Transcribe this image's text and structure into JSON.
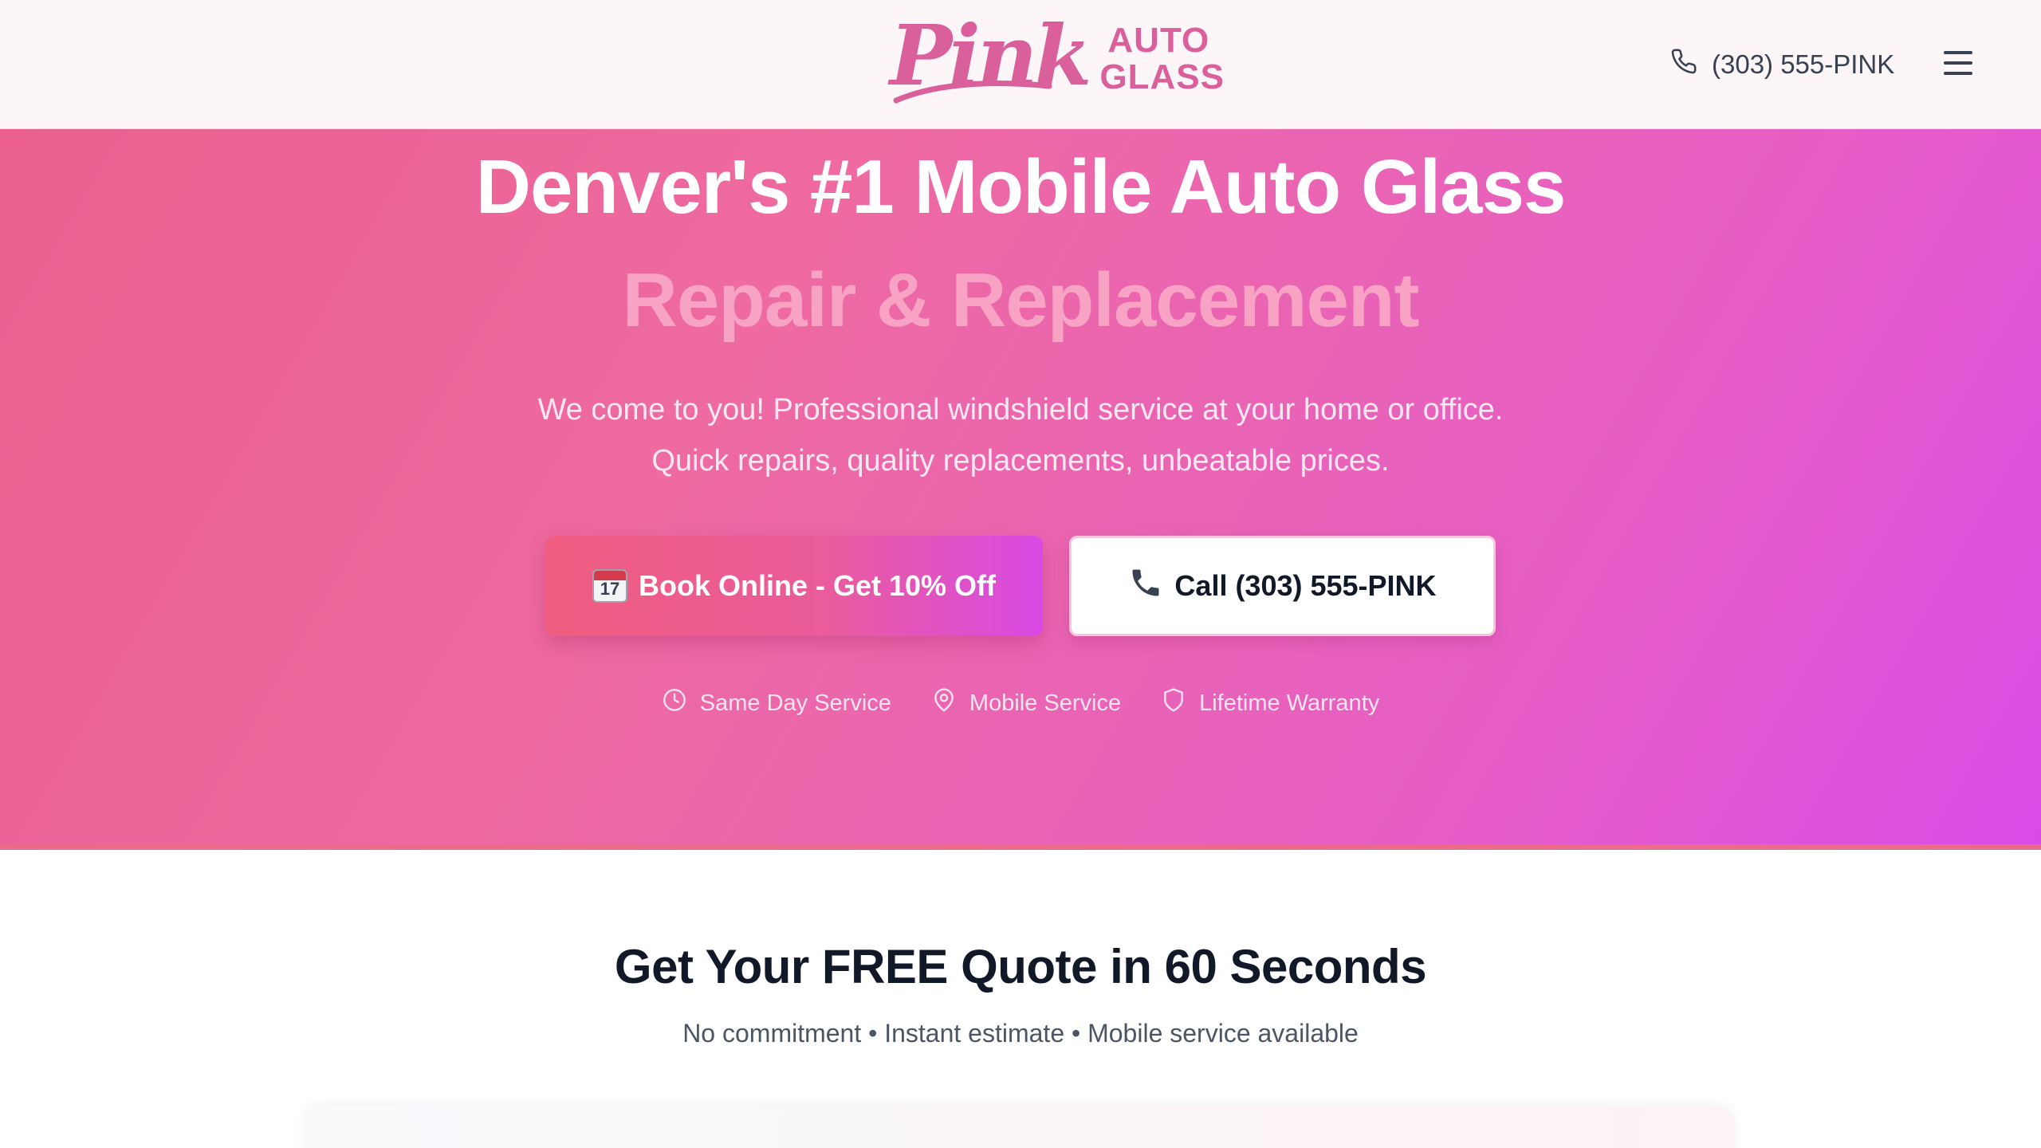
{
  "header": {
    "logo_script": "Pink",
    "logo_line1": "AUTO",
    "logo_line2": "GLASS",
    "phone": "(303) 555-PINK",
    "phone_icon": "phone-icon",
    "menu_icon": "hamburger-menu-icon"
  },
  "hero": {
    "title": "Denver's #1 Mobile Auto Glass",
    "subtitle": "Repair & Replacement",
    "desc_line1": "We come to you! Professional windshield service at your home or office.",
    "desc_line2": "Quick repairs, quality replacements, unbeatable prices.",
    "book_button": "Book Online - Get 10% Off",
    "book_icon": "calendar-icon",
    "calendar_day": "17",
    "call_button": "Call (303) 555-PINK",
    "call_icon": "telephone-icon",
    "features": [
      {
        "label": "Same Day Service",
        "icon": "clock-icon"
      },
      {
        "label": "Mobile Service",
        "icon": "map-pin-icon"
      },
      {
        "label": "Lifetime Warranty",
        "icon": "shield-icon"
      }
    ]
  },
  "quote": {
    "title": "Get Your FREE Quote in 60 Seconds",
    "subtitle": "No commitment • Instant estimate • Mobile service available"
  },
  "colors": {
    "brand_pink": "#d9609a",
    "hero_gradient_start": "#ea5f8f",
    "hero_gradient_end": "#d94be6",
    "subtitle_pink": "#f9a3c4"
  }
}
